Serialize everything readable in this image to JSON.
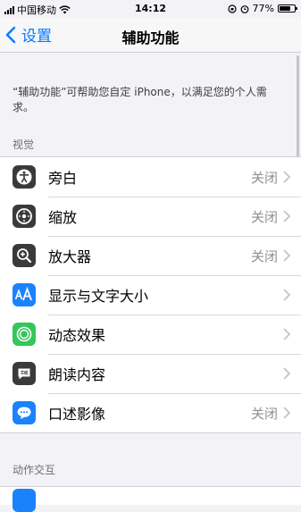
{
  "status_bar": {
    "carrier": "中国移动",
    "time": "14:12",
    "battery": "77%",
    "battery_level": 0.77
  },
  "nav": {
    "back_label": "设置",
    "title": "辅助功能"
  },
  "description": "“辅助功能”可帮助您自定 iPhone，以满足您的个人需求。",
  "sections": {
    "vision": {
      "header": "视觉"
    },
    "interaction": {
      "header": "动作交互"
    }
  },
  "vision_items": [
    {
      "label": "旁白",
      "value": "关闭",
      "icon": "voiceover-icon",
      "color": "#3a3a3c"
    },
    {
      "label": "缩放",
      "value": "关闭",
      "icon": "zoom-icon",
      "color": "#3a3a3c"
    },
    {
      "label": "放大器",
      "value": "关闭",
      "icon": "magnifier-icon",
      "color": "#3a3a3c"
    },
    {
      "label": "显示与文字大小",
      "value": "",
      "icon": "text-size-icon",
      "color": "#1a82fb"
    },
    {
      "label": "动态效果",
      "value": "",
      "icon": "motion-icon",
      "color": "#34c759"
    },
    {
      "label": "朗读内容",
      "value": "",
      "icon": "spoken-content-icon",
      "color": "#3a3a3c"
    },
    {
      "label": "口述影像",
      "value": "关闭",
      "icon": "audio-description-icon",
      "color": "#1a82fb"
    }
  ]
}
